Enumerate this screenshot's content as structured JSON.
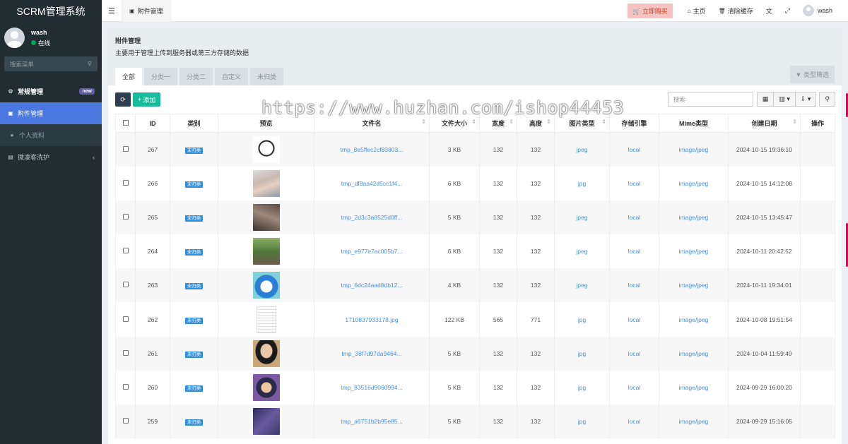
{
  "app": {
    "title": "SCRM管理系统"
  },
  "user": {
    "name": "wash",
    "status": "在线"
  },
  "sidebar": {
    "search_placeholder": "搜索菜单",
    "items": [
      {
        "label": "常规管理",
        "icon": "cogs-icon",
        "badge": "new"
      },
      {
        "label": "附件管理",
        "icon": "file-image-icon"
      },
      {
        "label": "个人资料",
        "icon": "user-icon"
      },
      {
        "label": "微凌客洗护",
        "icon": "folder-icon"
      }
    ]
  },
  "topbar": {
    "tab_label": "附件管理",
    "buy_label": "立即购买",
    "home_label": "主页",
    "clear_label": "清除缓存",
    "user_name": "wash"
  },
  "page": {
    "title": "附件管理",
    "description": "主要用于管理上传到服务器或第三方存储的数据",
    "tabs": [
      "全部",
      "分类一",
      "分类二",
      "自定义",
      "未归类"
    ],
    "filter_label": "类型筛选",
    "add_label": "添加",
    "search_placeholder": "搜索"
  },
  "table": {
    "headers": [
      "ID",
      "类别",
      "预览",
      "文件名",
      "文件大小",
      "宽度",
      "高度",
      "图片类型",
      "存储引擎",
      "Mime类型",
      "创建日期",
      "操作"
    ],
    "rows": [
      {
        "id": "267",
        "category": "未归类",
        "filename": "tmp_8e5ffec2cf83803...",
        "size": "3 KB",
        "width": "132",
        "height": "132",
        "imgtype": "jpeg",
        "storage": "local",
        "mime": "image/jpeg",
        "date": "2024-10-15 19:36:10"
      },
      {
        "id": "266",
        "category": "未归类",
        "filename": "tmp_df8aa42d5cc1f4...",
        "size": "6 KB",
        "width": "132",
        "height": "132",
        "imgtype": "jpg",
        "storage": "local",
        "mime": "image/jpeg",
        "date": "2024-10-15 14:12:08"
      },
      {
        "id": "265",
        "category": "未归类",
        "filename": "tmp_2d3c3a8525d0ff...",
        "size": "5 KB",
        "width": "132",
        "height": "132",
        "imgtype": "jpeg",
        "storage": "local",
        "mime": "image/jpeg",
        "date": "2024-10-15 13:45:47"
      },
      {
        "id": "264",
        "category": "未归类",
        "filename": "tmp_e977e7ac005b7...",
        "size": "6 KB",
        "width": "132",
        "height": "132",
        "imgtype": "jpeg",
        "storage": "local",
        "mime": "image/jpeg",
        "date": "2024-10-11 20:42:52"
      },
      {
        "id": "263",
        "category": "未归类",
        "filename": "tmp_6dc24aad8db12...",
        "size": "4 KB",
        "width": "132",
        "height": "132",
        "imgtype": "jpeg",
        "storage": "local",
        "mime": "image/jpeg",
        "date": "2024-10-11 19:34:01"
      },
      {
        "id": "262",
        "category": "未归类",
        "filename": "1710837933178.jpg",
        "size": "122 KB",
        "width": "565",
        "height": "771",
        "imgtype": "jpg",
        "storage": "local",
        "mime": "image/jpeg",
        "date": "2024-10-08 19:51:54"
      },
      {
        "id": "261",
        "category": "未归类",
        "filename": "tmp_38f7d97da9464...",
        "size": "5 KB",
        "width": "132",
        "height": "132",
        "imgtype": "jpg",
        "storage": "local",
        "mime": "image/jpeg",
        "date": "2024-10-04 11:59:49"
      },
      {
        "id": "260",
        "category": "未归类",
        "filename": "tmp_83516d9060994...",
        "size": "5 KB",
        "width": "132",
        "height": "132",
        "imgtype": "jpg",
        "storage": "local",
        "mime": "image/jpeg",
        "date": "2024-09-29 16:00:20"
      },
      {
        "id": "259",
        "category": "未归类",
        "filename": "tmp_a6751b2b95e85...",
        "size": "5 KB",
        "width": "132",
        "height": "132",
        "imgtype": "jpg",
        "storage": "local",
        "mime": "image/jpeg",
        "date": "2024-09-29 15:16:05"
      }
    ]
  },
  "watermark": "https://www.huzhan.com/ishop44453"
}
